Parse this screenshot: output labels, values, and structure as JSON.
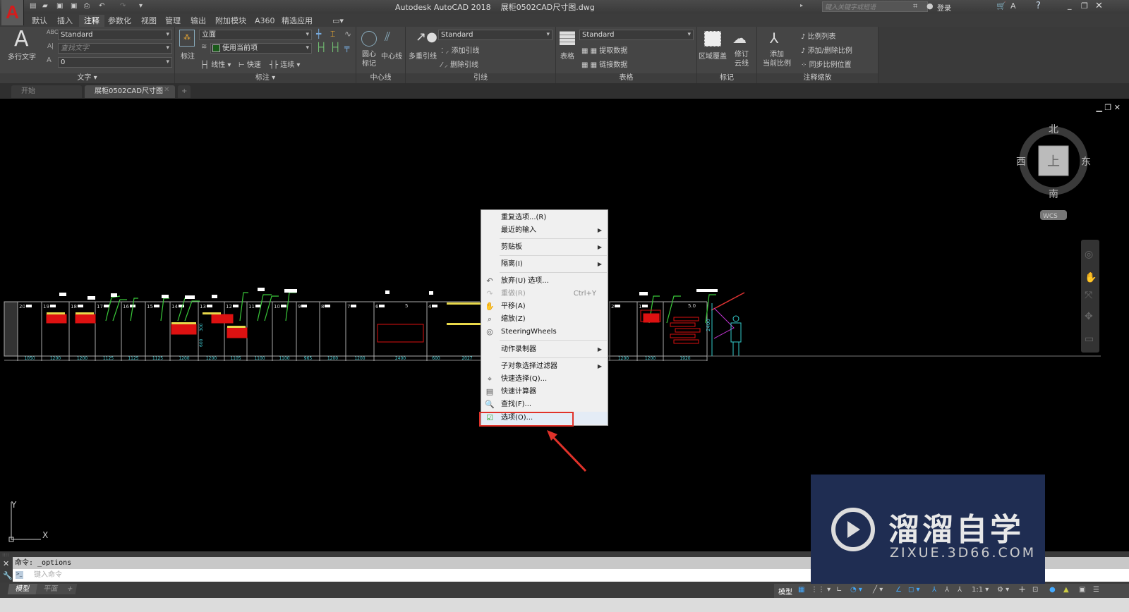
{
  "window": {
    "title": "Autodesk AutoCAD 2018    展柜0502CAD尺寸图.dwg",
    "search_placeholder": "键入关键字或短语",
    "sign_in": "登录"
  },
  "ribbon_tabs": [
    "默认",
    "插入",
    "注释",
    "参数化",
    "视图",
    "管理",
    "输出",
    "附加模块",
    "A360",
    "精选应用"
  ],
  "active_ribbon_tab": "注释",
  "panels": {
    "text": {
      "title": "文字 ▾",
      "big_button": "多行文字",
      "style": "Standard",
      "find_placeholder": "查找文字",
      "height": "0"
    },
    "dims": {
      "title": "标注 ▾",
      "big_button": "标注",
      "dimstyle": "立面",
      "layer": "使用当前项",
      "linear": "线性",
      "quick": "快速",
      "continue": "连续"
    },
    "centerlines": {
      "title": "中心线",
      "center_mark": "圆心\n标记",
      "centerline": "中心线"
    },
    "leaders": {
      "title": "引线",
      "big_button": "多重引线",
      "style": "Standard",
      "add": "添加引线",
      "remove": "删除引线"
    },
    "tables": {
      "title": "表格",
      "big_button": "表格",
      "style": "Standard",
      "extract": "提取数据",
      "link": "链接数据"
    },
    "markup": {
      "title": "标记",
      "wipeout": "区域覆盖",
      "revcloud": "修订\n云线"
    },
    "scaling": {
      "title": "注释缩放",
      "add_scale": "添加\n当前比例",
      "scale_list": "比例列表",
      "add_delete": "添加/删除比例",
      "sync": "同步比例位置"
    }
  },
  "file_tabs": [
    {
      "label": "开始"
    },
    {
      "label": "展柜0502CAD尺寸图*"
    }
  ],
  "viewcube": {
    "north": "北",
    "south": "南",
    "east": "东",
    "west": "西",
    "face": "上",
    "ucs": "WCS"
  },
  "ucs_icon": {
    "x": "X",
    "y": "Y"
  },
  "drawing": {
    "cell_numbers": [
      "20",
      "19",
      "18",
      "17",
      "16",
      "15",
      "14",
      "13",
      "12",
      "11",
      "10",
      "9",
      "8",
      "7",
      "6",
      "4",
      "",
      "2",
      "1",
      ""
    ],
    "dimensions": [
      "1050",
      "1200",
      "1200",
      "1125",
      "1125",
      "1125",
      "1200",
      "1200",
      "1105",
      "1100",
      "1100",
      "965",
      "1200",
      "1200",
      "2400",
      "600",
      "2027",
      "1200",
      "1200",
      "1920"
    ],
    "height_dims": [
      "300",
      "600",
      "2400"
    ],
    "extra_labels": [
      "5",
      "5.0"
    ]
  },
  "context_menu": {
    "items": [
      {
        "label": "重复选项...(R)",
        "icon": ""
      },
      {
        "label": "最近的输入",
        "submenu": true
      },
      {
        "label": "剪贴板",
        "submenu": true
      },
      {
        "label": "隔离(I)",
        "submenu": true
      },
      {
        "label": "放弃(U) 选项...",
        "icon": "undo-icon"
      },
      {
        "label": "重做(R)",
        "shortcut": "Ctrl+Y",
        "disabled": true,
        "icon": "redo-icon"
      },
      {
        "label": "平移(A)",
        "icon": "pan-icon"
      },
      {
        "label": "缩放(Z)",
        "icon": "zoom-icon"
      },
      {
        "label": "SteeringWheels",
        "icon": "steeringwheel-icon"
      },
      {
        "label": "动作录制器",
        "submenu": true
      },
      {
        "label": "子对象选择过滤器",
        "submenu": true
      },
      {
        "label": "快速选择(Q)...",
        "icon": "quick-select-icon"
      },
      {
        "label": "快速计算器",
        "icon": "calculator-icon"
      },
      {
        "label": "查找(F)...",
        "icon": "find-icon"
      },
      {
        "label": "选项(O)...",
        "icon": "options-icon",
        "highlighted": true
      }
    ]
  },
  "command": {
    "history": "命令: _options",
    "placeholder": "键入命令"
  },
  "layout_tabs": [
    "模型",
    "平面"
  ],
  "status": {
    "model": "模型",
    "scale": "1:1"
  },
  "watermark": {
    "brand": "溜溜自学",
    "url": "ZIXUE.3D66.COM"
  },
  "colors": {
    "highlight_box": "#e0322a",
    "watermark_bg": "#1f2d52",
    "canvas": "#000000",
    "dim_text": "#3fc8d0"
  }
}
